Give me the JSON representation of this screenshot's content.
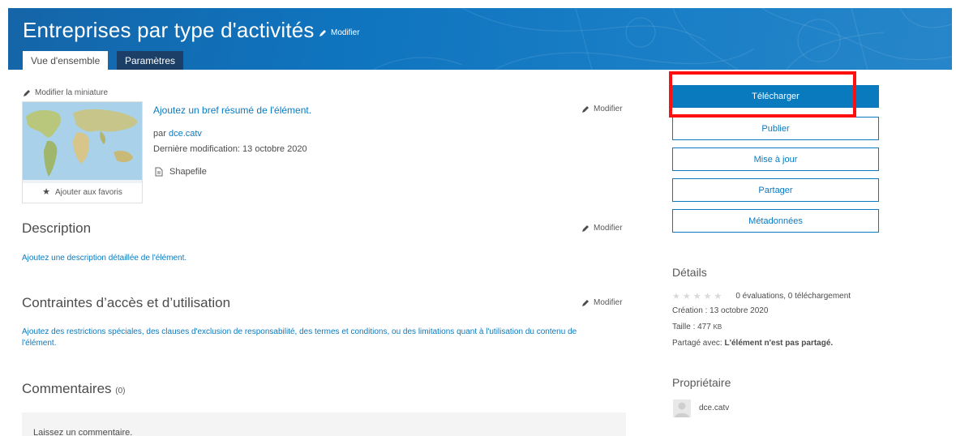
{
  "header": {
    "title": "Entreprises par type d'activités",
    "edit_label": "Modifier",
    "tabs": [
      {
        "label": "Vue d'ensemble",
        "active": true
      },
      {
        "label": "Paramètres",
        "active": false
      }
    ],
    "banner_color": "#0f74be"
  },
  "item": {
    "edit_thumbnail_label": "Modifier la miniature",
    "favorite_label": "Ajouter aux favoris",
    "summary_link": "Ajoutez un bref résumé de l'élément.",
    "by_prefix": "par",
    "owner": "dce.catv",
    "last_modified": "Dernière modification: 13 octobre 2020",
    "type": "Shapefile",
    "edit_label": "Modifier"
  },
  "description": {
    "title": "Description",
    "edit_label": "Modifier",
    "link": "Ajoutez une description détaillée de l'élément."
  },
  "constraints": {
    "title": "Contraintes d’accès et d’utilisation",
    "edit_label": "Modifier",
    "link": "Ajoutez des restrictions spéciales, des clauses d'exclusion de responsabilité, des termes et conditions, ou des limitations quant à l'utilisation du contenu de l'élément."
  },
  "comments": {
    "title": "Commentaires",
    "count": "(0)",
    "placeholder": "Laissez un commentaire."
  },
  "actions": {
    "download": "Télécharger",
    "publish": "Publier",
    "update": "Mise à jour",
    "share": "Partager",
    "metadata": "Métadonnées",
    "accent_color": "#0a7abf",
    "highlight_color": "#ff1010"
  },
  "details": {
    "title": "Détails",
    "rating_text": "0 évaluations, 0 téléchargement",
    "created": "Création : 13 octobre 2020",
    "size_label": "Taille : 477",
    "size_unit": "KB",
    "shared_label": "Partagé avec:",
    "shared_value": "L'élément n'est pas partagé."
  },
  "owner_section": {
    "title": "Propriétaire",
    "name": "dce.catv"
  }
}
